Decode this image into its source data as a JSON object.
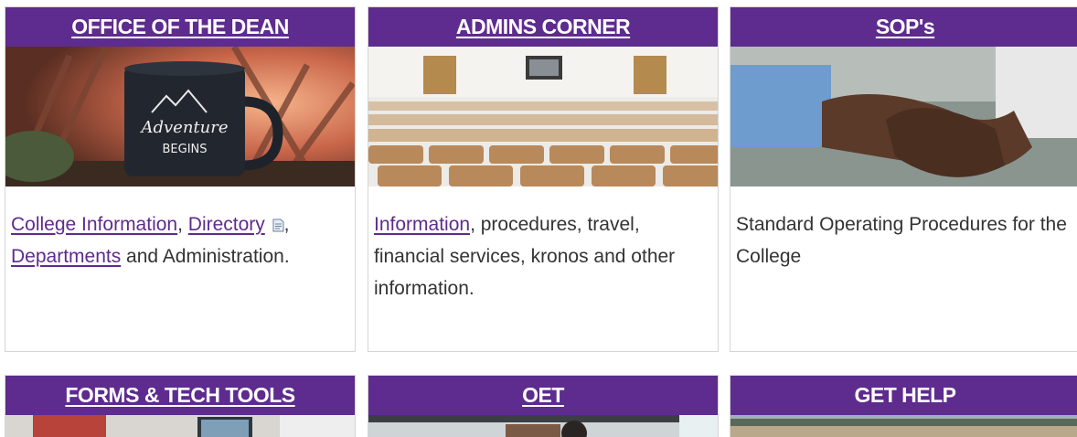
{
  "cards": [
    {
      "title": "OFFICE OF THE DEAN",
      "image": "adventure-mug-photo",
      "links": {
        "college_info": "College Information",
        "sep1": ", ",
        "directory": "Directory",
        "sep2": ",",
        "departments": "Departments",
        "tail": " and Administration."
      }
    },
    {
      "title": "ADMINS CORNER",
      "image": "lecture-hall-seats-photo",
      "links": {
        "information": "Information",
        "tail": ", procedures, travel, financial services, kronos and other information."
      }
    },
    {
      "title": "SOP's",
      "image": "handshake-photo",
      "text": "Standard Operating Procedures for the College"
    },
    {
      "title": "FORMS & TECH TOOLS",
      "image": "office-workspace-photo"
    },
    {
      "title": "OET",
      "image": "students-laptop-photo"
    },
    {
      "title": "GET HELP",
      "image": "campus-field-photo"
    }
  ],
  "colors": {
    "header_bg": "#5e2b8e",
    "link": "#5e2b8e",
    "text": "#333333",
    "border": "#d5d5d5"
  },
  "icons": {
    "directory_doc": "document-icon"
  }
}
